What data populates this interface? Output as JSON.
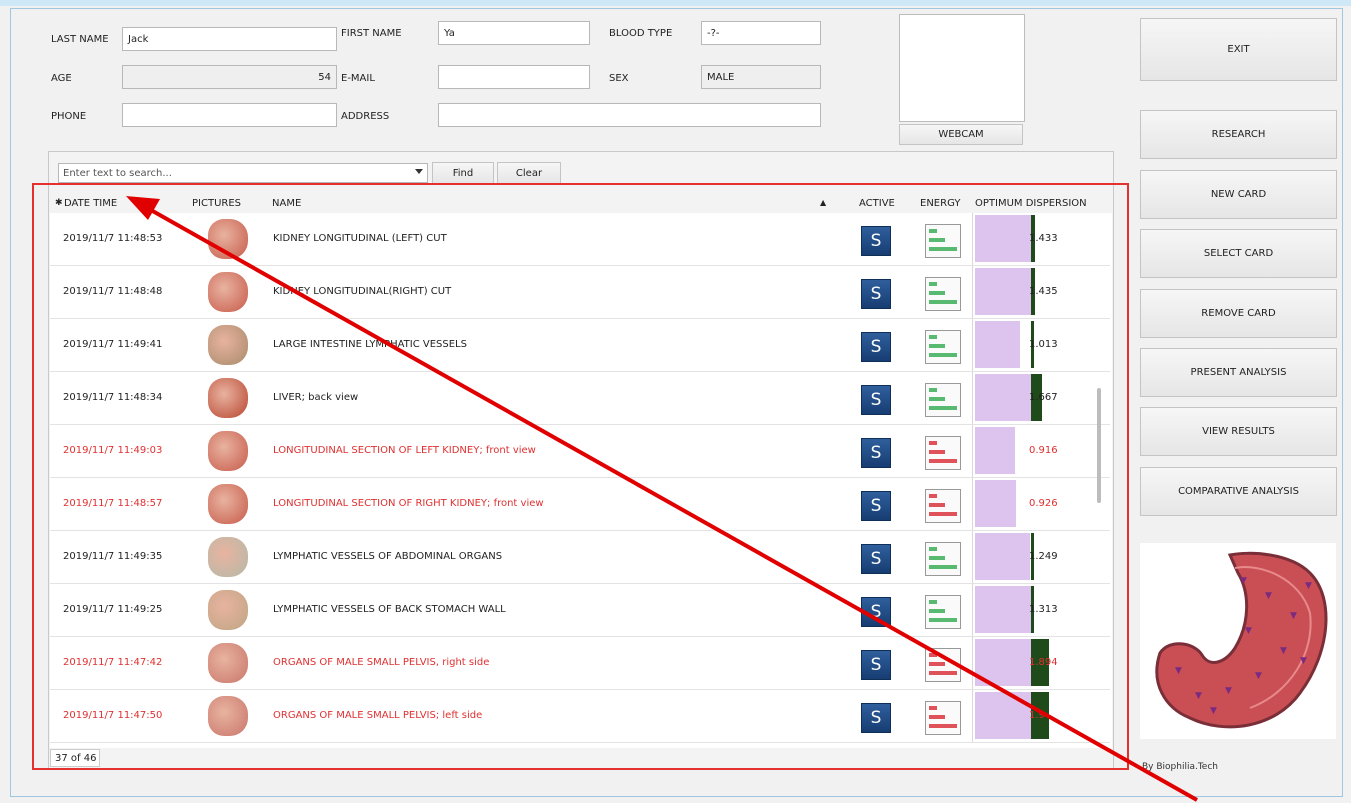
{
  "patient": {
    "last_name_label": "LAST NAME",
    "last_name": "Jack",
    "first_name_label": "FIRST NAME",
    "first_name": "Ya",
    "blood_type_label": "BLOOD TYPE",
    "blood_type": "-?-",
    "age_label": "AGE",
    "age": "54",
    "email_label": "E-MAIL",
    "email": "",
    "sex_label": "SEX",
    "sex": "MALE",
    "phone_label": "PHONE",
    "phone": "",
    "address_label": "ADDRESS",
    "address": ""
  },
  "webcam_label": "WEBCAM",
  "search": {
    "placeholder": "Enter text to search...",
    "find_label": "Find",
    "clear_label": "Clear"
  },
  "table": {
    "columns": {
      "datetime": "DATE TIME",
      "pictures": "PICTURES",
      "name": "NAME",
      "active": "ACTIVE",
      "energy": "ENERGY",
      "optimum": "OPTIMUM DISPERSION"
    },
    "rows": [
      {
        "datetime": "2019/11/7 11:48:53",
        "name": "KIDNEY LONGITUDINAL (LEFT) CUT",
        "value": "1.433",
        "alert": false,
        "energy": "green"
      },
      {
        "datetime": "2019/11/7 11:48:48",
        "name": "KIDNEY LONGITUDINAL(RIGHT) CUT",
        "value": "1.435",
        "alert": false,
        "energy": "green"
      },
      {
        "datetime": "2019/11/7 11:49:41",
        "name": "LARGE INTESTINE LYMPHATIC VESSELS",
        "value": "1.013",
        "alert": false,
        "energy": "green"
      },
      {
        "datetime": "2019/11/7 11:48:34",
        "name": "LIVER; back view",
        "value": "1.667",
        "alert": false,
        "energy": "green"
      },
      {
        "datetime": "2019/11/7 11:49:03",
        "name": "LONGITUDINAL  SECTION  OF  LEFT  KIDNEY; front view",
        "value": "0.916",
        "alert": true,
        "energy": "red"
      },
      {
        "datetime": "2019/11/7 11:48:57",
        "name": "LONGITUDINAL  SECTION  OF  RIGHT  KIDNEY; front view",
        "value": "0.926",
        "alert": true,
        "energy": "red"
      },
      {
        "datetime": "2019/11/7 11:49:35",
        "name": "LYMPHATIC VESSELS OF ABDOMINAL ORGANS",
        "value": "1.249",
        "alert": false,
        "energy": "green"
      },
      {
        "datetime": "2019/11/7 11:49:25",
        "name": "LYMPHATIC VESSELS OF BACK STOMACH WALL",
        "value": "1.313",
        "alert": false,
        "energy": "green"
      },
      {
        "datetime": "2019/11/7 11:47:42",
        "name": "ORGANS OF MALE SMALL PELVIS, right side",
        "value": "1.894",
        "alert": true,
        "energy": "red"
      },
      {
        "datetime": "2019/11/7 11:47:50",
        "name": "ORGANS OF MALE SMALL PELVIS; left side",
        "value": "1.9",
        "alert": true,
        "energy": "red"
      }
    ],
    "active_label": "S",
    "count": "37 of 46"
  },
  "sidebar": {
    "exit": "EXIT",
    "research": "RESEARCH",
    "new_card": "NEW CARD",
    "select_card": "SELECT CARD",
    "remove_card": "REMOVE CARD",
    "present_analysis": "PRESENT ANALYSIS",
    "view_results": "VIEW RESULTS",
    "comparative_analysis": "COMPARATIVE ANALYSIS"
  },
  "byline": "By Biophilia.Tech",
  "colors": {
    "alert": "#e03030",
    "annotation": "#e00000",
    "active_button": "#1f4a86"
  }
}
